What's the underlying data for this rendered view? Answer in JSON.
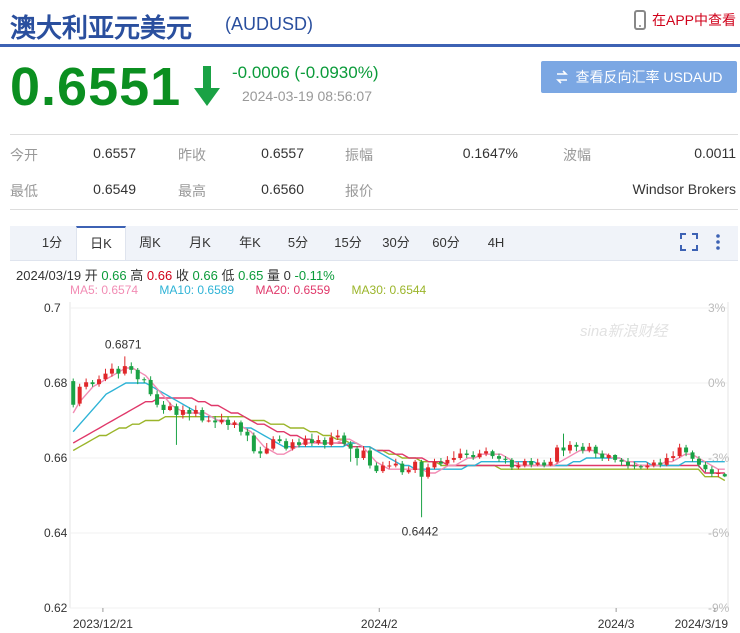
{
  "header": {
    "title": "澳大利亚元美元",
    "code": "(AUDUSD)",
    "app_label": "在APP中查看"
  },
  "quote": {
    "price": "0.6551",
    "change": "-0.0006 (-0.0930%)",
    "time": "2024-03-19 08:56:07",
    "reverse_button": "查看反向汇率 USDAUD",
    "up_color": "#d0021b",
    "down_color": "#0b8f20"
  },
  "stats": [
    [
      {
        "label": "今开",
        "value": "0.6557"
      },
      {
        "label": "昨收",
        "value": "0.6557"
      },
      {
        "label": "振幅",
        "value": "0.1647%"
      },
      {
        "label": "波幅",
        "value": "0.0011"
      }
    ],
    [
      {
        "label": "最低",
        "value": "0.6549"
      },
      {
        "label": "最高",
        "value": "0.6560"
      },
      {
        "label": "报价",
        "value": ""
      },
      {
        "label": "",
        "value": "Windsor Brokers"
      }
    ]
  ],
  "tabs": [
    "1分",
    "日K",
    "周K",
    "月K",
    "年K",
    "5分",
    "15分",
    "30分",
    "60分",
    "4H"
  ],
  "active_tab": "日K",
  "ohlc_line": {
    "date": "2024/03/19",
    "open_label": "开",
    "open": "0.66",
    "high_label": "高",
    "high": "0.66",
    "close_label": "收",
    "close": "0.66",
    "low_label": "低",
    "low": "0.65",
    "vol_label": "量",
    "vol": "0",
    "pct": "-0.11%"
  },
  "ma_line": [
    {
      "label": "MA5: 0.6574",
      "color": "#f28cb4"
    },
    {
      "label": "MA10: 0.6589",
      "color": "#2eb3d6"
    },
    {
      "label": "MA20: 0.6559",
      "color": "#e0386a"
    },
    {
      "label": "MA30: 0.6544",
      "color": "#9bb52a"
    }
  ],
  "chart_data": {
    "type": "candlestick",
    "ylim": [
      0.62,
      0.7
    ],
    "y_ticks": [
      "0.7",
      "0.68",
      "0.66",
      "0.64",
      "0.62"
    ],
    "pct_ticks": [
      "3%",
      "0%",
      "-3%",
      "-6%",
      "-9%"
    ],
    "x_labels": [
      "2023/12/21",
      "2024/2",
      "2024/3",
      "2024/3/19"
    ],
    "annotations": [
      {
        "text": "0.6871",
        "value": 0.6871
      },
      {
        "text": "0.6442",
        "value": 0.6442
      }
    ],
    "watermark": "sina新浪财经",
    "candles": [
      [
        0.6805,
        0.6742,
        0.6812,
        0.6735
      ],
      [
        0.6745,
        0.679,
        0.6798,
        0.6738
      ],
      [
        0.679,
        0.6802,
        0.6812,
        0.6783
      ],
      [
        0.6802,
        0.6797,
        0.6808,
        0.679
      ],
      [
        0.6797,
        0.681,
        0.682,
        0.679
      ],
      [
        0.681,
        0.6825,
        0.6838,
        0.6805
      ],
      [
        0.6825,
        0.6838,
        0.6852,
        0.6817
      ],
      [
        0.6838,
        0.6825,
        0.6845,
        0.6812
      ],
      [
        0.6825,
        0.6845,
        0.6871,
        0.682
      ],
      [
        0.6845,
        0.6835,
        0.6855,
        0.6825
      ],
      [
        0.6835,
        0.681,
        0.684,
        0.6797
      ],
      [
        0.681,
        0.6808,
        0.6815,
        0.68
      ],
      [
        0.6808,
        0.677,
        0.6818,
        0.6765
      ],
      [
        0.677,
        0.6742,
        0.678,
        0.6735
      ],
      [
        0.6742,
        0.6728,
        0.6752,
        0.6718
      ],
      [
        0.6728,
        0.6738,
        0.6748,
        0.6725
      ],
      [
        0.6738,
        0.6715,
        0.6745,
        0.6635
      ],
      [
        0.6715,
        0.6728,
        0.674,
        0.6705
      ],
      [
        0.6728,
        0.6718,
        0.6735,
        0.67
      ],
      [
        0.6718,
        0.6728,
        0.674,
        0.671
      ],
      [
        0.6728,
        0.67,
        0.6735,
        0.6695
      ],
      [
        0.67,
        0.67,
        0.6712,
        0.6695
      ],
      [
        0.67,
        0.6695,
        0.6712,
        0.668
      ],
      [
        0.6695,
        0.6702,
        0.6718,
        0.669
      ],
      [
        0.6702,
        0.6688,
        0.671,
        0.6675
      ],
      [
        0.6688,
        0.6695,
        0.67,
        0.668
      ],
      [
        0.6695,
        0.667,
        0.67,
        0.666
      ],
      [
        0.667,
        0.666,
        0.6678,
        0.6645
      ],
      [
        0.666,
        0.6618,
        0.6668,
        0.6612
      ],
      [
        0.6618,
        0.6612,
        0.663,
        0.66
      ],
      [
        0.6612,
        0.6625,
        0.664,
        0.661
      ],
      [
        0.6625,
        0.665,
        0.6658,
        0.662
      ],
      [
        0.665,
        0.6645,
        0.666,
        0.664
      ],
      [
        0.6645,
        0.6625,
        0.6652,
        0.662
      ],
      [
        0.6625,
        0.6642,
        0.665,
        0.662
      ],
      [
        0.6642,
        0.6635,
        0.6652,
        0.6628
      ],
      [
        0.6635,
        0.665,
        0.666,
        0.663
      ],
      [
        0.665,
        0.664,
        0.6665,
        0.6632
      ],
      [
        0.664,
        0.6648,
        0.666,
        0.6635
      ],
      [
        0.6648,
        0.6635,
        0.6655,
        0.6625
      ],
      [
        0.6635,
        0.6655,
        0.6668,
        0.663
      ],
      [
        0.6655,
        0.666,
        0.6675,
        0.6648
      ],
      [
        0.666,
        0.6638,
        0.6668,
        0.6632
      ],
      [
        0.6638,
        0.6625,
        0.6645,
        0.659
      ],
      [
        0.6625,
        0.66,
        0.6632,
        0.658
      ],
      [
        0.66,
        0.662,
        0.6632,
        0.6595
      ],
      [
        0.662,
        0.658,
        0.6628,
        0.6572
      ],
      [
        0.658,
        0.6565,
        0.6588,
        0.656
      ],
      [
        0.6565,
        0.658,
        0.659,
        0.656
      ],
      [
        0.658,
        0.658,
        0.6592,
        0.6572
      ],
      [
        0.658,
        0.6585,
        0.6598,
        0.6575
      ],
      [
        0.6585,
        0.6562,
        0.6592,
        0.6555
      ],
      [
        0.6562,
        0.6568,
        0.6578,
        0.6558
      ],
      [
        0.6568,
        0.659,
        0.6595,
        0.656
      ],
      [
        0.659,
        0.655,
        0.6595,
        0.6442
      ],
      [
        0.655,
        0.6575,
        0.6585,
        0.6545
      ],
      [
        0.6575,
        0.659,
        0.6598,
        0.657
      ],
      [
        0.659,
        0.6585,
        0.66,
        0.6578
      ],
      [
        0.6585,
        0.6595,
        0.6605,
        0.658
      ],
      [
        0.6595,
        0.66,
        0.6618,
        0.6588
      ],
      [
        0.66,
        0.6612,
        0.6625,
        0.6595
      ],
      [
        0.6612,
        0.6608,
        0.6622,
        0.66
      ],
      [
        0.6608,
        0.6602,
        0.6618,
        0.6595
      ],
      [
        0.6602,
        0.6612,
        0.6622,
        0.6598
      ],
      [
        0.6612,
        0.6618,
        0.6628,
        0.6605
      ],
      [
        0.6618,
        0.6605,
        0.6622,
        0.6598
      ],
      [
        0.6605,
        0.6598,
        0.6612,
        0.659
      ],
      [
        0.6598,
        0.6595,
        0.6605,
        0.6585
      ],
      [
        0.6595,
        0.6575,
        0.66,
        0.6568
      ],
      [
        0.6575,
        0.658,
        0.659,
        0.657
      ],
      [
        0.658,
        0.6592,
        0.6598,
        0.6575
      ],
      [
        0.6592,
        0.6582,
        0.66,
        0.6575
      ],
      [
        0.6582,
        0.6588,
        0.6598,
        0.6578
      ],
      [
        0.6588,
        0.658,
        0.6595,
        0.6575
      ],
      [
        0.658,
        0.659,
        0.66,
        0.6578
      ],
      [
        0.659,
        0.6628,
        0.6635,
        0.6585
      ],
      [
        0.6628,
        0.662,
        0.6665,
        0.6605
      ],
      [
        0.662,
        0.6635,
        0.6645,
        0.6612
      ],
      [
        0.6635,
        0.663,
        0.6642,
        0.6618
      ],
      [
        0.663,
        0.662,
        0.664,
        0.6612
      ],
      [
        0.662,
        0.663,
        0.664,
        0.6615
      ],
      [
        0.663,
        0.6612,
        0.6635,
        0.66
      ],
      [
        0.6612,
        0.66,
        0.662,
        0.6592
      ],
      [
        0.66,
        0.6608,
        0.6612,
        0.6592
      ],
      [
        0.6608,
        0.6595,
        0.661,
        0.6588
      ],
      [
        0.6595,
        0.659,
        0.66,
        0.658
      ],
      [
        0.659,
        0.658,
        0.66,
        0.6572
      ],
      [
        0.658,
        0.6578,
        0.659,
        0.657
      ],
      [
        0.6578,
        0.6575,
        0.6582,
        0.657
      ],
      [
        0.6575,
        0.658,
        0.6588,
        0.657
      ],
      [
        0.658,
        0.6588,
        0.6595,
        0.6575
      ],
      [
        0.6588,
        0.6582,
        0.6598,
        0.6575
      ],
      [
        0.6582,
        0.66,
        0.6612,
        0.6578
      ],
      [
        0.66,
        0.6605,
        0.6618,
        0.6592
      ],
      [
        0.6605,
        0.6628,
        0.6638,
        0.66
      ],
      [
        0.6628,
        0.6615,
        0.6635,
        0.6605
      ],
      [
        0.6615,
        0.6598,
        0.662,
        0.659
      ],
      [
        0.6598,
        0.6582,
        0.6605,
        0.6575
      ],
      [
        0.6582,
        0.657,
        0.659,
        0.6562
      ],
      [
        0.657,
        0.6558,
        0.6578,
        0.655
      ],
      [
        0.6558,
        0.656,
        0.657,
        0.6549
      ],
      [
        0.6557,
        0.6551,
        0.656,
        0.6549
      ]
    ],
    "ma5": [
      0.672,
      0.675,
      0.677,
      0.679,
      0.68,
      0.681,
      0.682,
      0.683,
      0.684,
      0.684,
      0.683,
      0.682,
      0.68,
      0.678,
      0.676,
      0.674,
      0.673,
      0.672,
      0.672,
      0.672,
      0.672,
      0.671,
      0.67,
      0.67,
      0.669,
      0.669,
      0.668,
      0.667,
      0.665,
      0.663,
      0.662,
      0.661,
      0.661,
      0.662,
      0.663,
      0.664,
      0.664,
      0.664,
      0.664,
      0.664,
      0.664,
      0.665,
      0.665,
      0.664,
      0.663,
      0.661,
      0.659,
      0.658,
      0.657,
      0.657,
      0.657,
      0.657,
      0.657,
      0.657,
      0.656,
      0.656,
      0.657,
      0.658,
      0.658,
      0.659,
      0.66,
      0.66,
      0.661,
      0.661,
      0.661,
      0.661,
      0.66,
      0.659,
      0.658,
      0.658,
      0.658,
      0.658,
      0.658,
      0.658,
      0.659,
      0.66,
      0.661,
      0.662,
      0.662,
      0.662,
      0.661,
      0.661,
      0.66,
      0.66,
      0.659,
      0.659,
      0.658,
      0.658,
      0.658,
      0.658,
      0.659,
      0.659,
      0.66,
      0.661,
      0.661,
      0.66,
      0.659,
      0.658,
      0.657,
      0.657
    ],
    "ma10": [
      0.667,
      0.669,
      0.671,
      0.673,
      0.675,
      0.677,
      0.678,
      0.679,
      0.68,
      0.68,
      0.68,
      0.68,
      0.679,
      0.678,
      0.677,
      0.676,
      0.675,
      0.674,
      0.673,
      0.672,
      0.671,
      0.671,
      0.67,
      0.67,
      0.669,
      0.669,
      0.668,
      0.668,
      0.667,
      0.666,
      0.665,
      0.664,
      0.663,
      0.663,
      0.663,
      0.663,
      0.663,
      0.663,
      0.663,
      0.663,
      0.663,
      0.663,
      0.664,
      0.664,
      0.663,
      0.663,
      0.662,
      0.661,
      0.66,
      0.659,
      0.658,
      0.658,
      0.657,
      0.657,
      0.657,
      0.657,
      0.657,
      0.657,
      0.657,
      0.657,
      0.658,
      0.658,
      0.659,
      0.659,
      0.659,
      0.659,
      0.659,
      0.659,
      0.659,
      0.659,
      0.659,
      0.658,
      0.658,
      0.658,
      0.658,
      0.658,
      0.659,
      0.659,
      0.66,
      0.66,
      0.66,
      0.66,
      0.66,
      0.66,
      0.659,
      0.659,
      0.659,
      0.659,
      0.658,
      0.658,
      0.658,
      0.658,
      0.658,
      0.659,
      0.659,
      0.659,
      0.659,
      0.659,
      0.659,
      0.659
    ],
    "ma20": [
      0.664,
      0.665,
      0.666,
      0.667,
      0.668,
      0.669,
      0.67,
      0.671,
      0.672,
      0.673,
      0.674,
      0.675,
      0.675,
      0.676,
      0.676,
      0.676,
      0.676,
      0.676,
      0.676,
      0.675,
      0.675,
      0.674,
      0.674,
      0.673,
      0.672,
      0.672,
      0.671,
      0.67,
      0.669,
      0.669,
      0.668,
      0.667,
      0.667,
      0.666,
      0.666,
      0.665,
      0.665,
      0.664,
      0.664,
      0.664,
      0.664,
      0.664,
      0.663,
      0.663,
      0.663,
      0.663,
      0.662,
      0.662,
      0.662,
      0.661,
      0.661,
      0.66,
      0.66,
      0.66,
      0.659,
      0.659,
      0.659,
      0.658,
      0.658,
      0.658,
      0.658,
      0.658,
      0.658,
      0.658,
      0.658,
      0.658,
      0.658,
      0.658,
      0.658,
      0.658,
      0.658,
      0.658,
      0.658,
      0.658,
      0.658,
      0.658,
      0.658,
      0.658,
      0.658,
      0.658,
      0.658,
      0.658,
      0.658,
      0.658,
      0.658,
      0.658,
      0.658,
      0.658,
      0.658,
      0.658,
      0.658,
      0.658,
      0.658,
      0.658,
      0.658,
      0.658,
      0.656,
      0.656,
      0.656,
      0.656
    ],
    "ma30": [
      0.662,
      0.663,
      0.664,
      0.665,
      0.666,
      0.666,
      0.667,
      0.668,
      0.668,
      0.669,
      0.669,
      0.67,
      0.67,
      0.67,
      0.671,
      0.671,
      0.671,
      0.671,
      0.671,
      0.671,
      0.671,
      0.671,
      0.671,
      0.671,
      0.671,
      0.671,
      0.671,
      0.67,
      0.67,
      0.67,
      0.669,
      0.669,
      0.669,
      0.668,
      0.668,
      0.668,
      0.667,
      0.667,
      0.666,
      0.666,
      0.665,
      0.665,
      0.664,
      0.664,
      0.663,
      0.663,
      0.662,
      0.662,
      0.661,
      0.661,
      0.66,
      0.66,
      0.66,
      0.659,
      0.659,
      0.659,
      0.658,
      0.658,
      0.658,
      0.658,
      0.658,
      0.658,
      0.658,
      0.658,
      0.658,
      0.657,
      0.657,
      0.657,
      0.657,
      0.657,
      0.657,
      0.657,
      0.657,
      0.657,
      0.657,
      0.657,
      0.657,
      0.657,
      0.657,
      0.657,
      0.657,
      0.657,
      0.657,
      0.657,
      0.657,
      0.657,
      0.657,
      0.657,
      0.657,
      0.657,
      0.657,
      0.657,
      0.657,
      0.657,
      0.657,
      0.657,
      0.655,
      0.655,
      0.655,
      0.654
    ]
  }
}
